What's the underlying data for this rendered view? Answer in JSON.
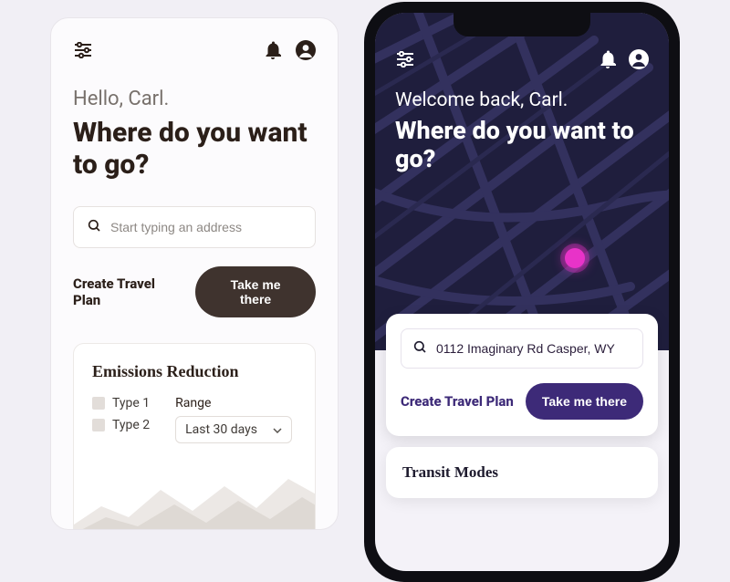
{
  "colors": {
    "light_bg": "#fcfbfd",
    "dark_btn": "#3f332e",
    "purple": "#3d2a78",
    "map_bg": "#1f1e3d",
    "map_street": "#2e2d57",
    "pin": "#e833c8"
  },
  "light": {
    "greeting": "Hello, Carl.",
    "title": "Where do you want to go?",
    "search_placeholder": "Start typing an address",
    "create_plan": "Create Travel Plan",
    "take_me_there": "Take me there",
    "emissions": {
      "heading": "Emissions Reduction",
      "legend": [
        "Type 1",
        "Type 2"
      ],
      "range_label": "Range",
      "range_value": "Last 30 days"
    }
  },
  "dark": {
    "greeting": "Welcome back, Carl.",
    "title": "Where do you want to go?",
    "search_value": "0112 Imaginary Rd Casper, WY",
    "create_plan": "Create Travel Plan",
    "take_me_there": "Take me there",
    "transit_heading": "Transit Modes"
  }
}
